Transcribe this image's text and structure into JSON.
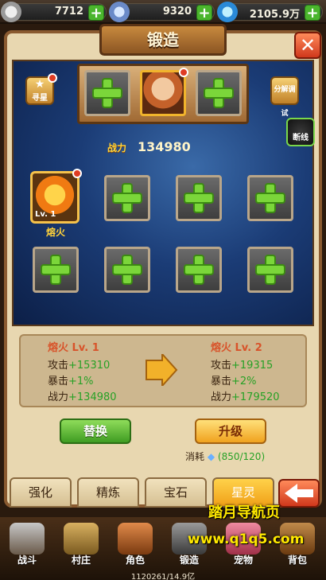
{
  "resources": [
    {
      "icon": "silver-coin-icon",
      "value": "7712"
    },
    {
      "icon": "crystal-icon",
      "value": "9320"
    },
    {
      "icon": "diamond-icon",
      "value": "2105.9万"
    }
  ],
  "title": "锻造",
  "side_left": {
    "label": "寻星"
  },
  "side_right": {
    "debug": "分解调试",
    "disconnect": "断线"
  },
  "power": {
    "label": "战力",
    "value": "134980"
  },
  "gem": {
    "level": "Lv. 1",
    "name": "熔火"
  },
  "stats": {
    "current": {
      "name": "熔火 Lv. 1",
      "attack_label": "攻击",
      "attack": "+15310",
      "crit_label": "暴击",
      "crit": "+1%",
      "power_label": "战力",
      "power": "+134980"
    },
    "next": {
      "name": "熔火 Lv. 2",
      "attack_label": "攻击",
      "attack": "+19315",
      "crit_label": "暴击",
      "crit": "+2%",
      "power_label": "战力",
      "power": "+179520"
    }
  },
  "buttons": {
    "replace": "替换",
    "upgrade": "升级"
  },
  "cost": {
    "label": "消耗",
    "value": "(850/120)"
  },
  "tabs": [
    "强化",
    "精炼",
    "宝石",
    "星灵"
  ],
  "nav": [
    "战斗",
    "村庄",
    "角色",
    "锻造",
    "宠物",
    "背包"
  ],
  "watermark": {
    "line1": "踏月导航页",
    "line2": "www.q1q5.com"
  },
  "footer": "1120261/14.9亿"
}
